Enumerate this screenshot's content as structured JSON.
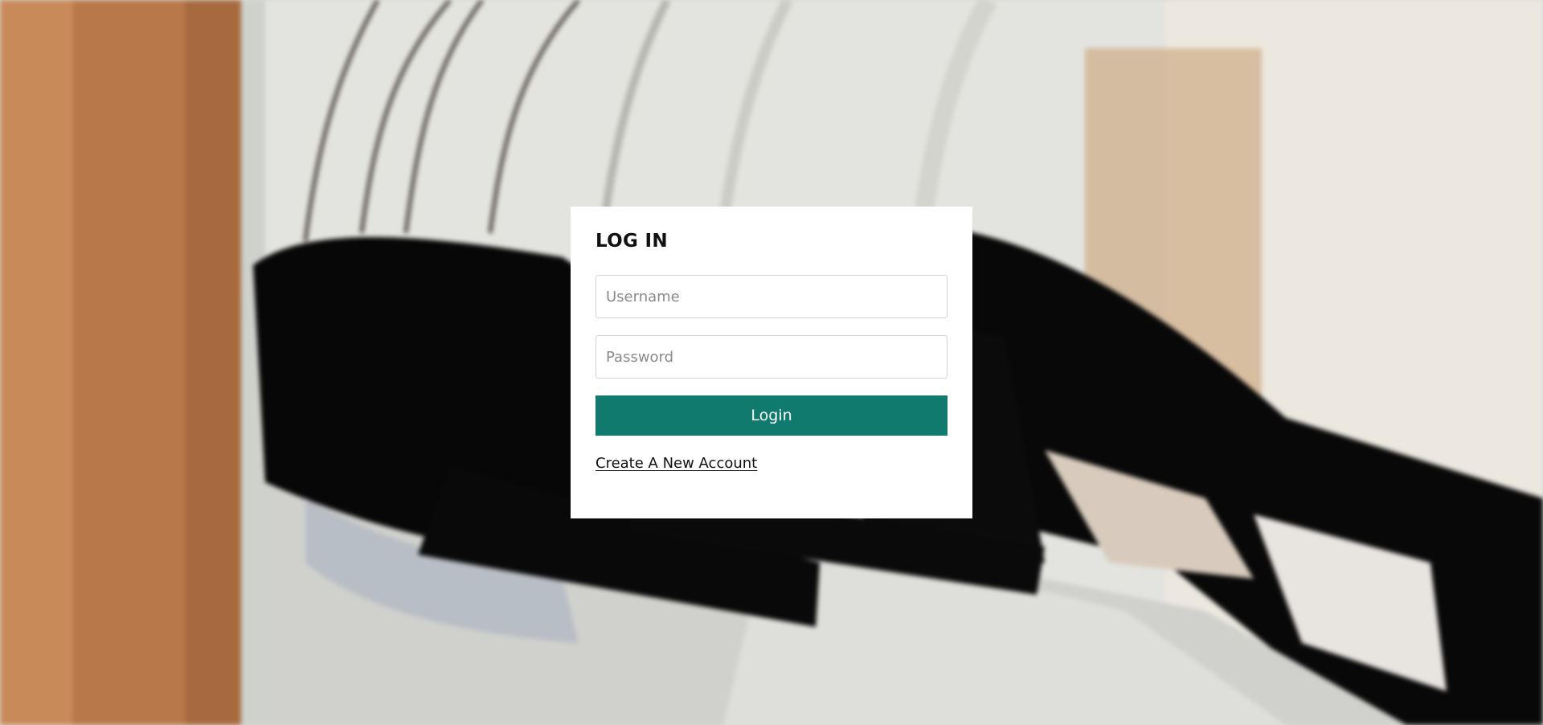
{
  "background": {
    "description_icon": "clothes-hanger-photo-icon"
  },
  "login_form": {
    "title": "LOG IN",
    "username_placeholder": "Username",
    "password_placeholder": "Password",
    "login_button_label": "Login",
    "create_account_link": "Create A New Account",
    "accent_color": "#117a6e"
  }
}
